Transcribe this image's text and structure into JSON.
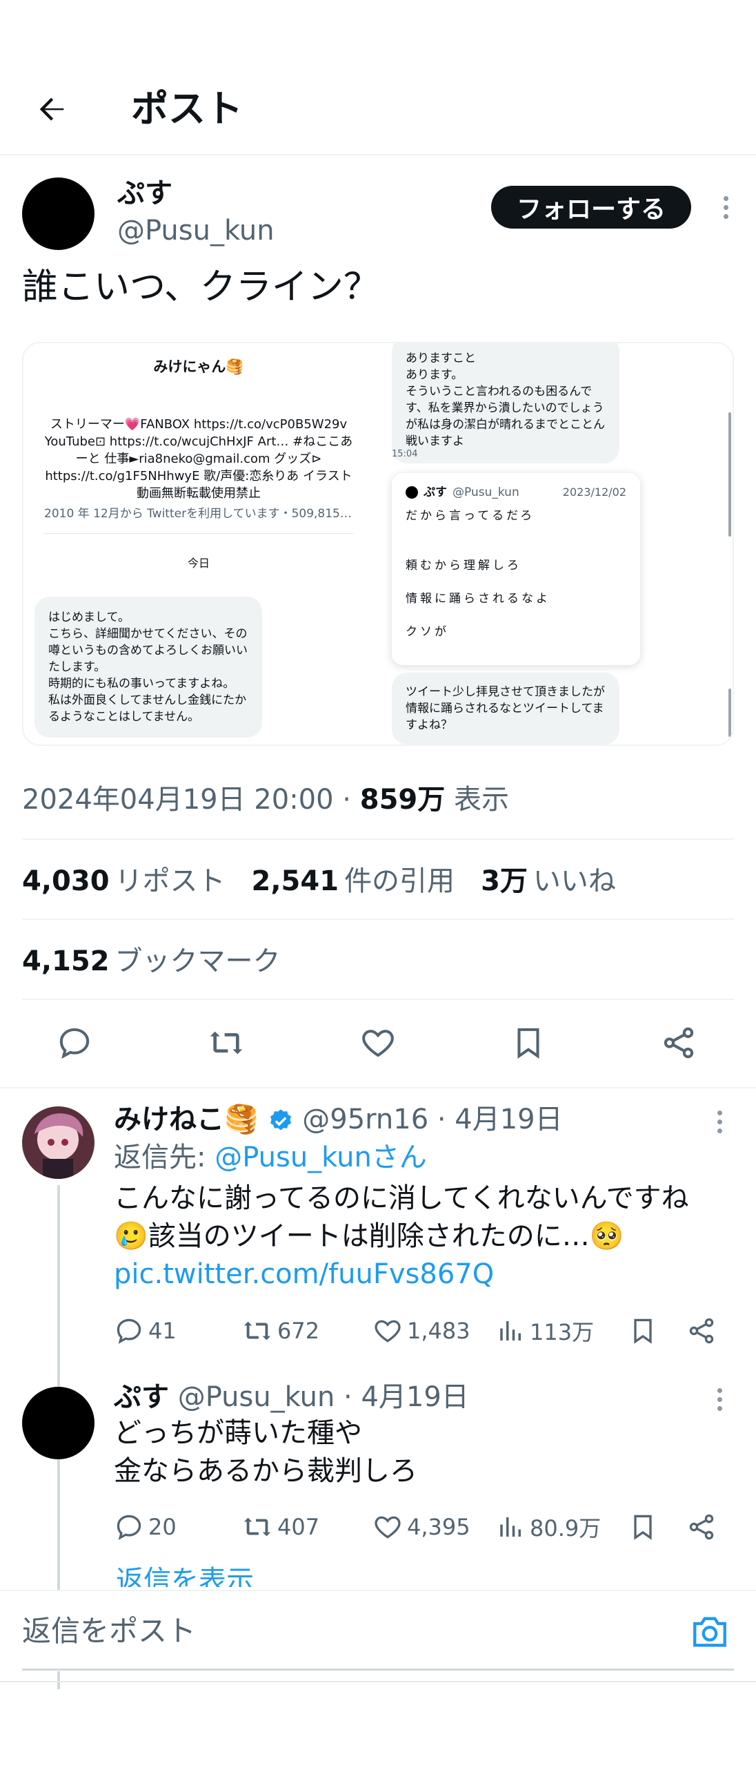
{
  "header": {
    "title": "ポスト",
    "back_icon": "arrow-left-icon"
  },
  "author": {
    "name": "ぷす",
    "handle": "@Pusu_kun",
    "follow_label": "フォローする"
  },
  "post": {
    "text": "誰こいつ、クライン？",
    "timestamp": "2024年04月19日 20:00 · ",
    "views_value": "859万",
    "views_label": " 表示",
    "reposts_value": "4,030",
    "reposts_label": "リポスト",
    "quotes_value": "2,541",
    "quotes_label": "件の引用",
    "likes_value": "3万",
    "likes_label": "いいね",
    "bookmarks_value": "4,152",
    "bookmarks_label": "ブックマーク"
  },
  "media": {
    "left": {
      "profile_name": "みけにゃん🥞",
      "bio": "ストリーマー💗FANBOX https://t.co/vcP0B5W29v YouTube⊡ https://t.co/wcujChHxJF Art… #ねここあーと 仕事►ria8neko@gmail.com グッズ⊳ https://t.co/g1F5NHhwyE 歌/声優:恋糸りあ イラスト動画無断転載使用禁止",
      "joined": "2010 年 12月から Twitterを利用しています・509,815…",
      "today_label": "今日",
      "message": "はじめまして。\nこちら、詳細聞かせてください、その噂というもの含めてよろしくお願いいたします。\n時期的にも私の事いってますよね。\n私は外面良くしてませんし金銭にたかるようなことはしてません。"
    },
    "right": {
      "message1": "ありますこと\nあります。\nそういうこと言われるのも困るんです、私を業界から潰したいのでしょうが私は身の潔白が晴れるまでとことん戦いますよ",
      "time": "15:04",
      "card_name": "ぷす",
      "card_handle": "@Pusu_kun",
      "card_date": "2023/12/02",
      "card_line1": "だから言ってるだろ",
      "card_line2": "頼むから理解しろ",
      "card_line3": "情報に踊らされるなよ",
      "card_line4": "クソが",
      "message2": "ツイート少し拝見させて頂きましたが情報に踊らされるなとツイートしてますよね？"
    }
  },
  "replies": [
    {
      "name": "みけねこ🥞",
      "handle_date": " @95rn16 · 4月19日",
      "reply_to_prefix": "返信先: ",
      "reply_to_user": "@Pusu_kunさん",
      "body_line1": "こんなに謝ってるのに消してくれないんですね",
      "body_line2": "🥲該当のツイートは削除されたのに…🥺",
      "link": "pic.twitter.com/fuuFvs867Q",
      "replies": "41",
      "reposts": "672",
      "likes": "1,483",
      "views": "113万"
    },
    {
      "name": "ぷす",
      "handle_date": " @Pusu_kun · 4月19日",
      "body_line1": "どっちが蒔いた種や",
      "body_line2": "金ならあるから裁判しろ",
      "replies": "20",
      "reposts": "407",
      "likes": "4,395",
      "views": "80.9万"
    }
  ],
  "show_replies_label": "返信を表示",
  "composer": {
    "placeholder": "返信をポスト",
    "camera_icon": "camera-icon"
  },
  "colors": {
    "accent": "#1d9bf0",
    "text": "#0f1419",
    "muted": "#536471"
  }
}
